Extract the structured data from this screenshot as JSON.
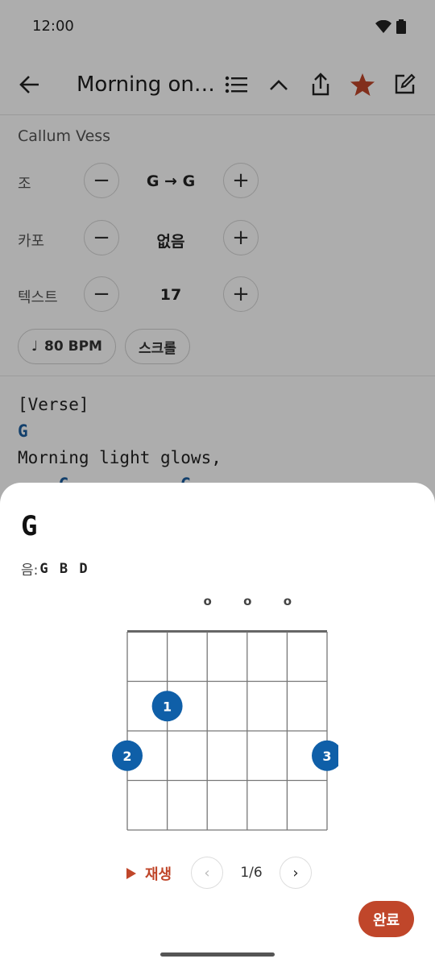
{
  "status": {
    "time": "12:00",
    "wifi_icon": "wifi-icon",
    "battery_icon": "battery-icon"
  },
  "toolbar": {
    "title": "Morning on the Harbor",
    "icons": [
      "back-arrow-icon",
      "list-icon",
      "chevron-up-icon",
      "share-icon",
      "star-icon",
      "edit-icon"
    ],
    "star_color": "#c0462a"
  },
  "song": {
    "artist": "Callum Vess",
    "key": {
      "label": "조",
      "value": "G → G"
    },
    "capo": {
      "label": "카포",
      "value": "없음"
    },
    "text": {
      "label": "텍스트",
      "value": "17"
    },
    "bpm_chip": {
      "icon": "♩",
      "label": "80 BPM"
    },
    "scroll_chip": "스크롤",
    "minus": "−",
    "plus": "+"
  },
  "lyrics": {
    "section": "[Verse]",
    "chord_line_1": "G",
    "lyric_line_1": "Morning light glows,",
    "chord_line_2": "    C           G"
  },
  "sheet": {
    "chord": "G",
    "notes_label": "음:",
    "notes": "G B D",
    "open_strings_marker": "o",
    "fingers": [
      {
        "finger": "1",
        "string": 2,
        "fret": 2
      },
      {
        "finger": "2",
        "string": 1,
        "fret": 3
      },
      {
        "finger": "3",
        "string": 6,
        "fret": 3
      }
    ],
    "open_strings": [
      3,
      4,
      5
    ],
    "play_label": "재생",
    "prev": "‹",
    "next": "›",
    "page": "1/6",
    "done_label": "완료",
    "accent": "#c0462a",
    "dot_color": "#0f5fa8"
  }
}
